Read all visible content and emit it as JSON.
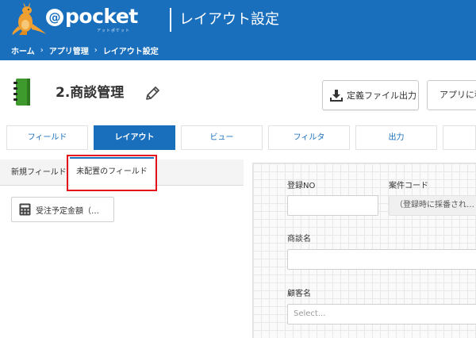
{
  "header": {
    "logo_at": "@",
    "logo_text": "pocket",
    "logo_sub": "アットポケット",
    "title": "レイアウト設定"
  },
  "breadcrumb": {
    "items": [
      "ホーム",
      "アプリ管理",
      "レイアウト設定"
    ],
    "separator": "›"
  },
  "app": {
    "title": "2.商談管理"
  },
  "buttons": {
    "export": "定義ファイル出力",
    "add_app": "アプリに移"
  },
  "main_tabs": [
    "フィールド",
    "レイアウト",
    "ビュー",
    "フィルタ",
    "出力",
    ""
  ],
  "subtabs": {
    "new": "新規フィールド",
    "unplaced": "未配置のフィールド"
  },
  "unplaced_fields": [
    {
      "label": "受注予定金額（…"
    }
  ],
  "form": {
    "reg_no_label": "登録NO",
    "case_code_label": "案件コード",
    "case_code_value": "（登録時に採番され…",
    "deal_name_label": "商談名",
    "customer_label": "顧客名",
    "customer_placeholder": "Select..."
  },
  "colors": {
    "brand_blue": "#1a6fbd",
    "highlight_red": "#e4121b"
  }
}
